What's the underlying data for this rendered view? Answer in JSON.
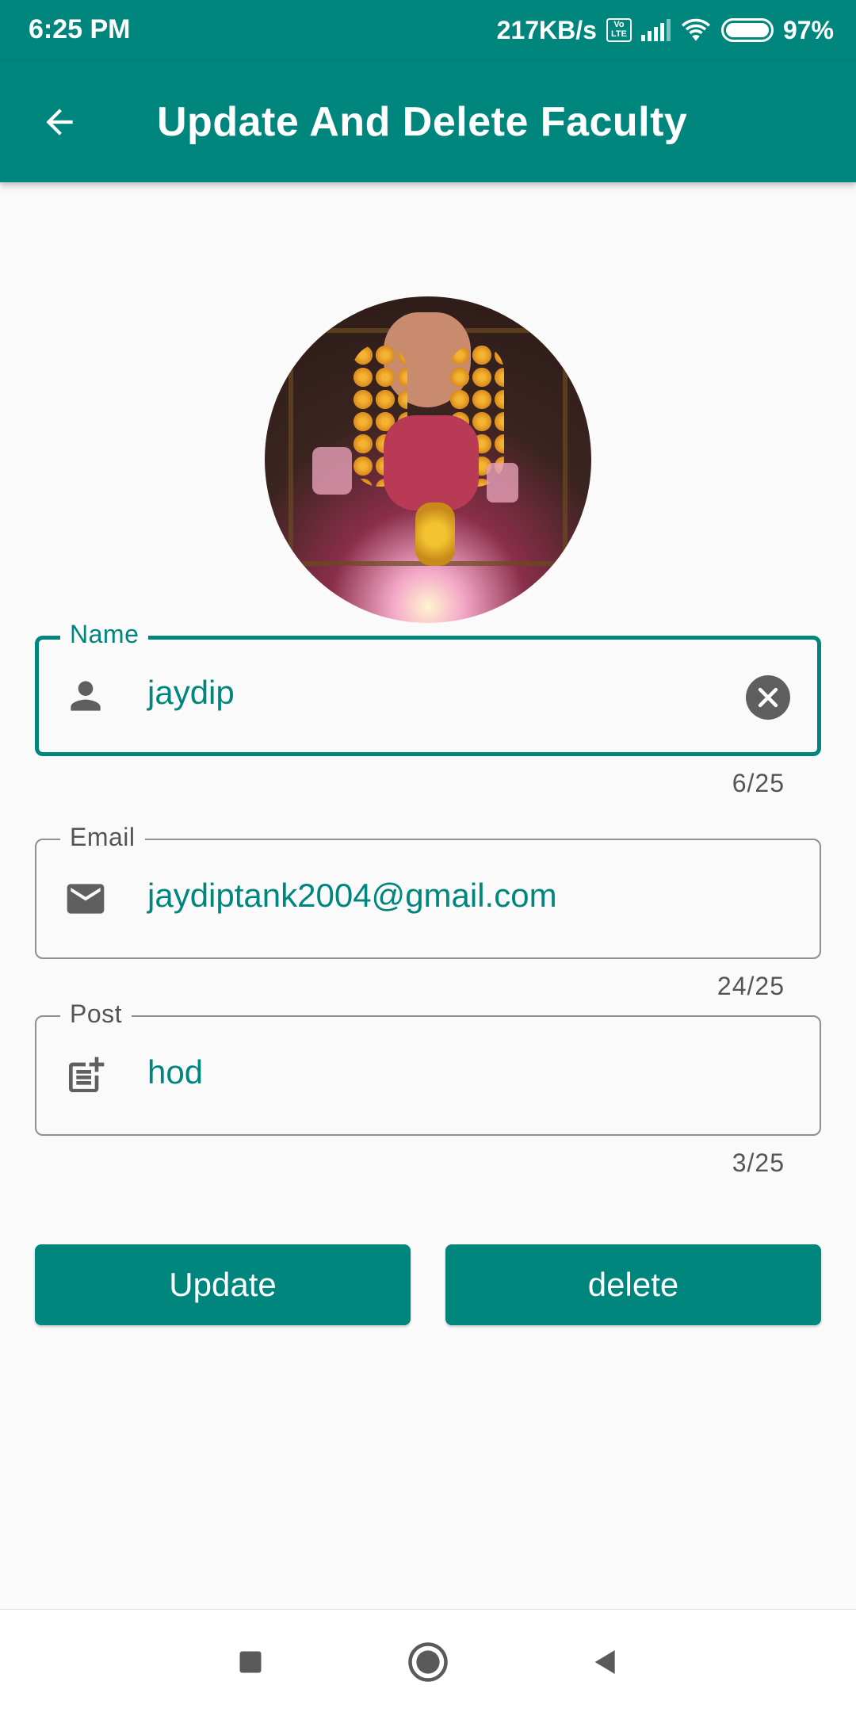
{
  "status_bar": {
    "time": "6:25 PM",
    "network_speed": "217KB/s",
    "volte": "Vo LTE",
    "battery": "97%",
    "icons": [
      "volte-icon",
      "signal-icon",
      "wifi-icon",
      "battery-icon"
    ]
  },
  "app_bar": {
    "title": "Update And Delete Faculty",
    "back_icon": "arrow-back-icon"
  },
  "profile": {
    "avatar_icon": "faculty-photo"
  },
  "form": {
    "name": {
      "label": "Name",
      "value": "jaydip",
      "counter": "6/25",
      "icon": "person-icon",
      "focused": true
    },
    "email": {
      "label": "Email",
      "value": "jaydiptank2004@gmail.com",
      "counter": "24/25",
      "icon": "mail-icon"
    },
    "post": {
      "label": "Post",
      "value": "hod",
      "counter": "3/25",
      "icon": "post-add-icon"
    }
  },
  "actions": {
    "update_label": "Update",
    "delete_label": "delete"
  },
  "nav_bar": {
    "icons": [
      "recents-icon",
      "home-icon",
      "back-icon"
    ]
  },
  "colors": {
    "primary": "#00867d",
    "background": "#fafafa",
    "outline": "#8f8f8f",
    "icon_gray": "#5f5f5f"
  }
}
